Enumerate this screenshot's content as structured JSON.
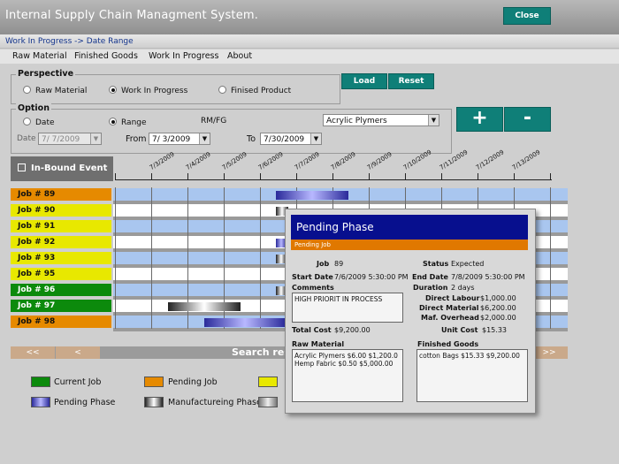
{
  "app": {
    "title": "Internal Supply Chain Managment System.",
    "close_label": "Close"
  },
  "breadcrumb": "Work In Progress -> Date Range",
  "menu": [
    "Raw Material",
    "Finished Goods",
    "Work In Progress",
    "About"
  ],
  "perspective": {
    "title": "Perspective",
    "options": [
      "Raw Material",
      "Work In Progress",
      "Finised Product"
    ],
    "selected": "Work In Progress"
  },
  "buttons": {
    "load": "Load",
    "reset": "Reset",
    "plus": "+",
    "minus": "-"
  },
  "option": {
    "title": "Option",
    "date_radio": "Date",
    "range_radio": "Range",
    "selected": "Range",
    "rmfg_label": "RM/FG",
    "material_select": "Acrylic Plymers",
    "date_label": "Date",
    "date_value": "7/ 7/2009",
    "from_label": "From",
    "from_value": "7/ 3/2009",
    "to_label": "To",
    "to_value": "7/30/2009"
  },
  "timeline": {
    "inbound_label": "In-Bound Event",
    "dates": [
      "7/3/2009",
      "7/4/2009",
      "7/5/2009",
      "7/6/2009",
      "7/7/2009",
      "7/8/2009",
      "7/9/2009",
      "7/10/2009",
      "7/11/2009",
      "7/12/2009",
      "7/13/2009"
    ]
  },
  "jobs": [
    {
      "label": "Job # 89",
      "color": "#e68a00"
    },
    {
      "label": "Job # 90",
      "color": "#e8e800"
    },
    {
      "label": "Job # 91",
      "color": "#e8e800"
    },
    {
      "label": "Job # 92",
      "color": "#e8e800"
    },
    {
      "label": "Job # 93",
      "color": "#e8e800"
    },
    {
      "label": "Job # 95",
      "color": "#e8e800"
    },
    {
      "label": "Job # 96",
      "color": "#0c8a0c"
    },
    {
      "label": "Job # 97",
      "color": "#0c8a0c"
    },
    {
      "label": "Job # 98",
      "color": "#e68a00"
    }
  ],
  "pager": {
    "first": "<<",
    "prev": "<",
    "search_label": "Search resul",
    "last": ">>"
  },
  "legend": [
    {
      "label": "Current Job",
      "color": "#0c8a0c"
    },
    {
      "label": "Pending Job",
      "color": "#e68a00"
    },
    {
      "label": "",
      "color": "#e8e800"
    },
    {
      "label": "Pending Phase",
      "color": "#3a3aaa"
    },
    {
      "label": "Manufactureing Phase",
      "color": "#222222"
    },
    {
      "label": "",
      "color": "#888888"
    }
  ],
  "popup": {
    "title": "Pending Phase",
    "subtitle": "Pending Job",
    "job_label": "Job",
    "job_value": "89",
    "status_label": "Status",
    "status_value": "Expected",
    "start_label": "Start Date",
    "start_value": "7/6/2009 5:30:00 PM",
    "end_label": "End Date",
    "end_value": "7/8/2009 5:30:00 PM",
    "comments_label": "Comments",
    "comments_value": "HIGH PRIORIT IN PROCESS",
    "duration_label": "Duration",
    "duration_value": "2 days",
    "dl_label": "Direct Labour",
    "dl_value": "$1,000.00",
    "dm_label": "Direct Material",
    "dm_value": "$6,200.00",
    "mo_label": "Maf. Overhead",
    "mo_value": "$2,000.00",
    "total_label": "Total Cost",
    "total_value": "$9,200.00",
    "unit_label": "Unit Cost",
    "unit_value": "$15.33",
    "raw_label": "Raw Material",
    "raw_items": [
      "Acrylic Plymers  $6.00  $1,200.0",
      "Hemp Fabric  $0.50  $5,000.00"
    ],
    "fg_label": "Finished Goods",
    "fg_items": [
      "cotton Bags  $15.33  $9,200.00"
    ]
  }
}
